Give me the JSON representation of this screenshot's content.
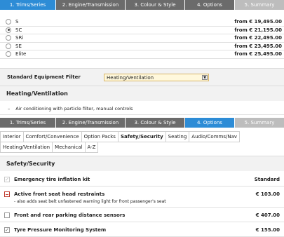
{
  "steps": [
    "1. Trims/Series",
    "2. Engine/Transmission",
    "3. Colour & Style",
    "4. Options",
    "5. Summary"
  ],
  "trims": [
    {
      "name": "S",
      "price": "from € 19,495.00",
      "selected": false
    },
    {
      "name": "SC",
      "price": "from € 21,195.00",
      "selected": true
    },
    {
      "name": "SRi",
      "price": "from € 22,495.00",
      "selected": false
    },
    {
      "name": "SE",
      "price": "from € 23,495.00",
      "selected": false
    },
    {
      "name": "Elite",
      "price": "from € 25,495.00",
      "selected": false
    }
  ],
  "filter": {
    "label": "Standard Equipment Filter",
    "value": "Heating/Ventilation"
  },
  "heating": {
    "title": "Heating/Ventilation",
    "items": [
      "Air conditioning with particle filter, manual controls"
    ]
  },
  "subtabs": [
    "Interior",
    "Comfort/Convenience",
    "Option Packs",
    "Safety/Security",
    "Seating",
    "Audio/Comms/Nav",
    "Heating/Ventilation",
    "Mechanical",
    "A-Z"
  ],
  "active_subtab": "Safety/Security",
  "safety": {
    "title": "Safety/Security",
    "options": [
      {
        "name": "Emergency tire inflation kit",
        "sub": "",
        "price": "Standard",
        "state": "standard"
      },
      {
        "name": "Active front seat head restraints",
        "sub": "- also adds seat belt unfastened warning light for front passenger's seat",
        "price": "€ 103.00",
        "state": "conflict"
      },
      {
        "name": "Front and rear parking distance sensors",
        "sub": "",
        "price": "€ 407.00",
        "state": "unchecked"
      },
      {
        "name": "Tyre Pressure Monitoring System",
        "sub": "",
        "price": "€ 155.00",
        "state": "checked"
      }
    ]
  },
  "icons": {
    "radio_selected": "radio-selected-icon",
    "dropdown": "chevron-down-icon",
    "check": "checkmark-icon"
  },
  "colors": {
    "active_step": "#2d8cd6",
    "inactive_step": "#6b6b6b",
    "disabled_step": "#bdbdbd"
  }
}
